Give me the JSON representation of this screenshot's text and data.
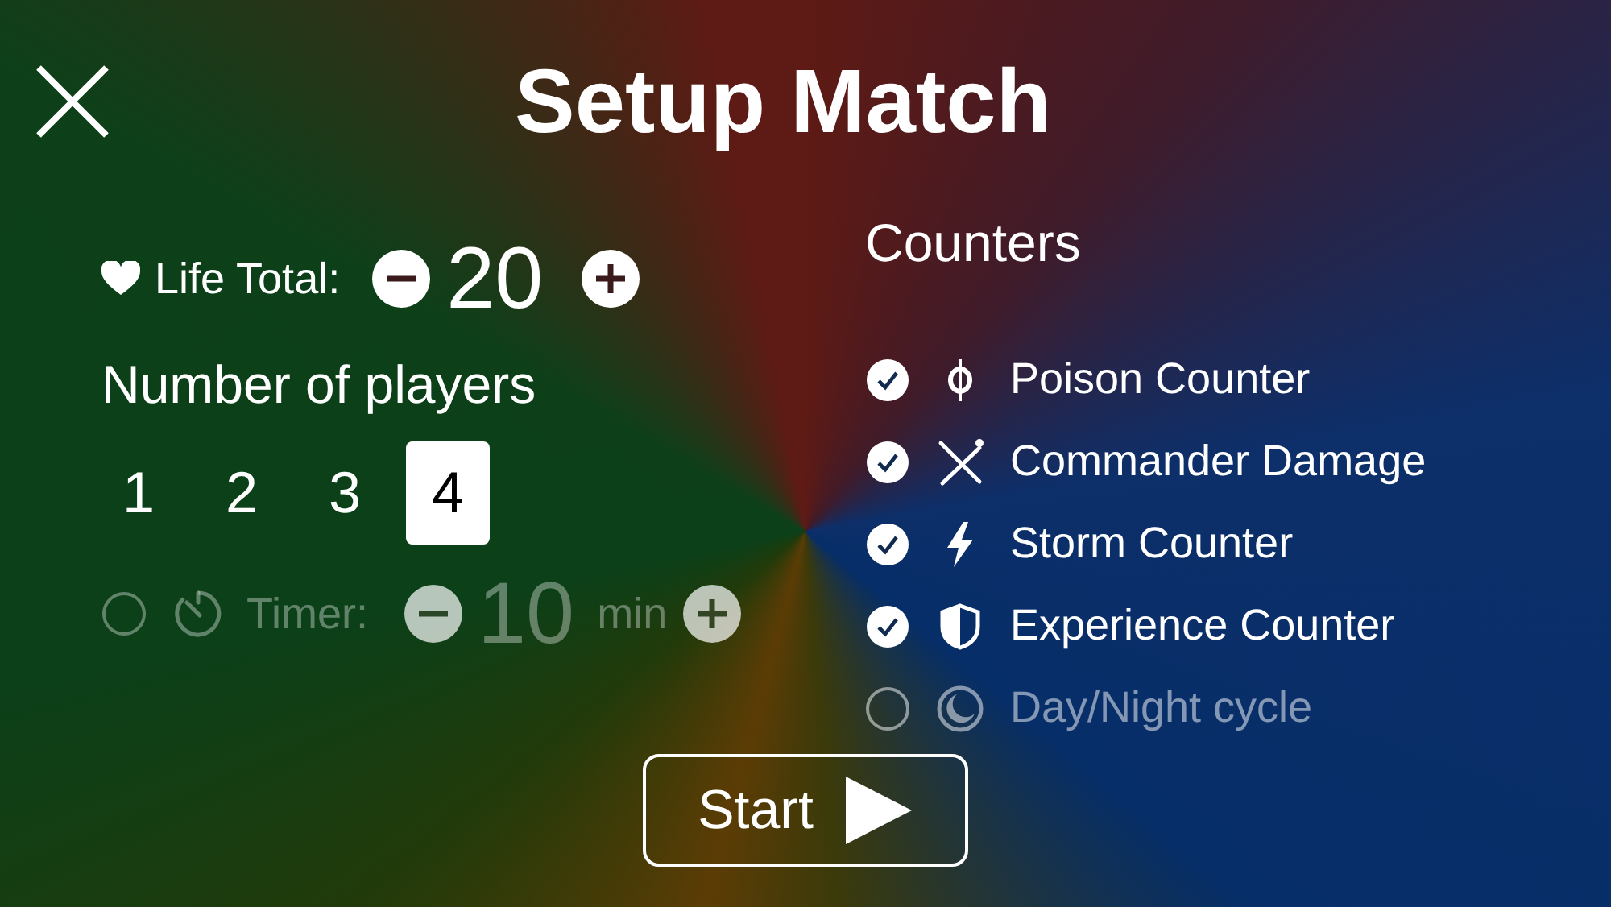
{
  "title": "Setup Match",
  "life_total": {
    "label": "Life Total:",
    "value": "20"
  },
  "players": {
    "label": "Number of players",
    "options": [
      {
        "label": "1",
        "selected": false
      },
      {
        "label": "2",
        "selected": false
      },
      {
        "label": "3",
        "selected": false
      },
      {
        "label": "4",
        "selected": true
      }
    ]
  },
  "timer": {
    "enabled": false,
    "label": "Timer:",
    "value": "10",
    "unit": "min"
  },
  "counters": {
    "title": "Counters",
    "items": [
      {
        "label": "Poison Counter",
        "kind": "poison",
        "checked": true
      },
      {
        "label": "Commander Damage",
        "kind": "commander",
        "checked": true
      },
      {
        "label": "Storm Counter",
        "kind": "storm",
        "checked": true
      },
      {
        "label": "Experience Counter",
        "kind": "experience",
        "checked": true
      },
      {
        "label": "Day/Night cycle",
        "kind": "daynight",
        "checked": false
      }
    ]
  },
  "start_button": {
    "label": "Start"
  }
}
